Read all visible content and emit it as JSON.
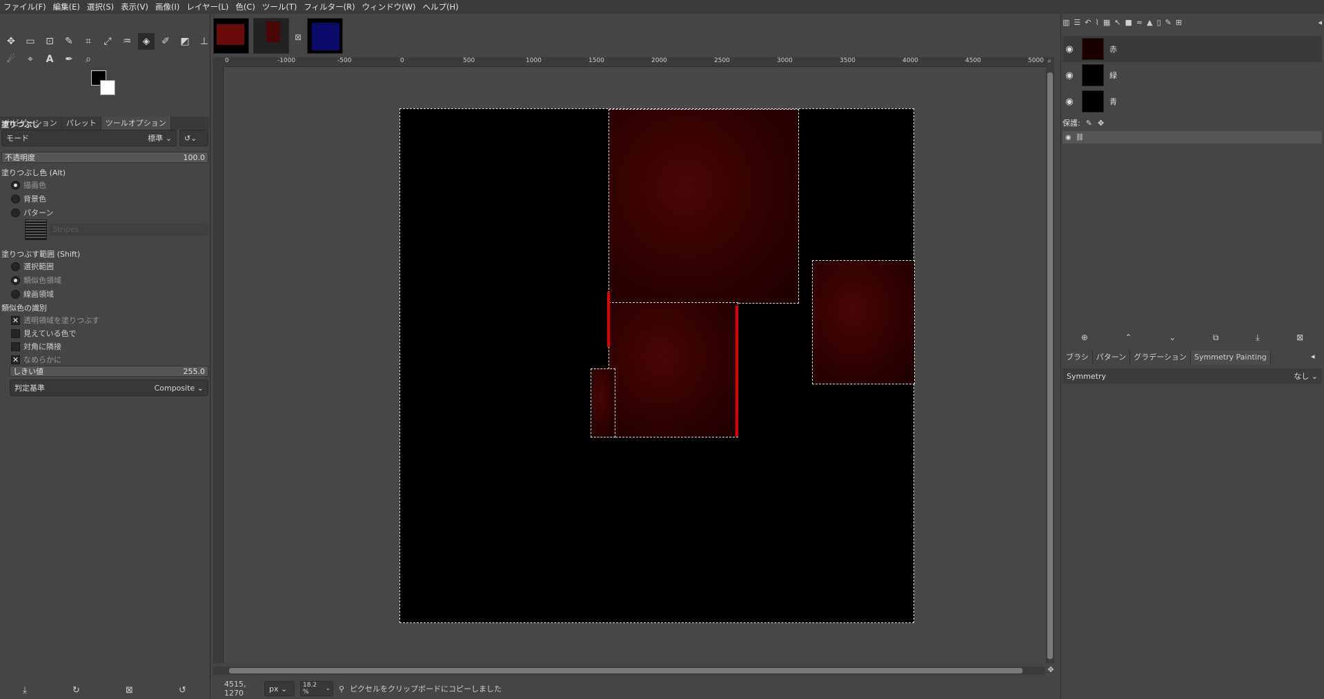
{
  "menu": [
    "ファイル(F)",
    "編集(E)",
    "選択(S)",
    "表示(V)",
    "画像(I)",
    "レイヤー(L)",
    "色(C)",
    "ツール(T)",
    "フィルター(R)",
    "ウィンドウ(W)",
    "ヘルプ(H)"
  ],
  "left_tabs": [
    "ナビゲーション",
    "パレット",
    "ツールオプション"
  ],
  "tool_options": {
    "title": "塗りつぶし",
    "mode_label": "モード",
    "mode_value": "標準",
    "opacity_label": "不透明度",
    "opacity_value": "100.0",
    "fill_color_label": "塗りつぶし色  (Alt)",
    "fill_options": [
      "描画色",
      "背景色",
      "パターン"
    ],
    "pattern_name": "Stripes",
    "fill_range_label": "塗りつぶす範囲 (Shift)",
    "range_options": [
      "選択範囲",
      "類似色領域",
      "線画領域"
    ],
    "similar_label": "類似色の識別",
    "checks": [
      "透明領域を塗りつぶす",
      "見えている色で",
      "対角に隣接",
      "なめらかに"
    ],
    "threshold_label": "しきい値",
    "threshold_value": "255.0",
    "criterion_label": "判定基準",
    "criterion_value": "Composite"
  },
  "ruler_labels": [
    "0",
    "-1000",
    "-500",
    "0",
    "500",
    "1000",
    "1500",
    "2000",
    "2500",
    "3000",
    "3500",
    "4000",
    "4500",
    "5000"
  ],
  "layers": [
    {
      "name": "赤"
    },
    {
      "name": "緑"
    },
    {
      "name": "青"
    }
  ],
  "lock_label": "保護:",
  "right_tabs": [
    "ブラシ",
    "パターン",
    "グラデーション",
    "Symmetry Painting"
  ],
  "symmetry_label": "Symmetry",
  "symmetry_value": "なし",
  "status": {
    "coords": "4515, 1270",
    "unit": "px",
    "zoom": "18.2 %",
    "message": "ピクセルをクリップボードにコピーしました"
  }
}
